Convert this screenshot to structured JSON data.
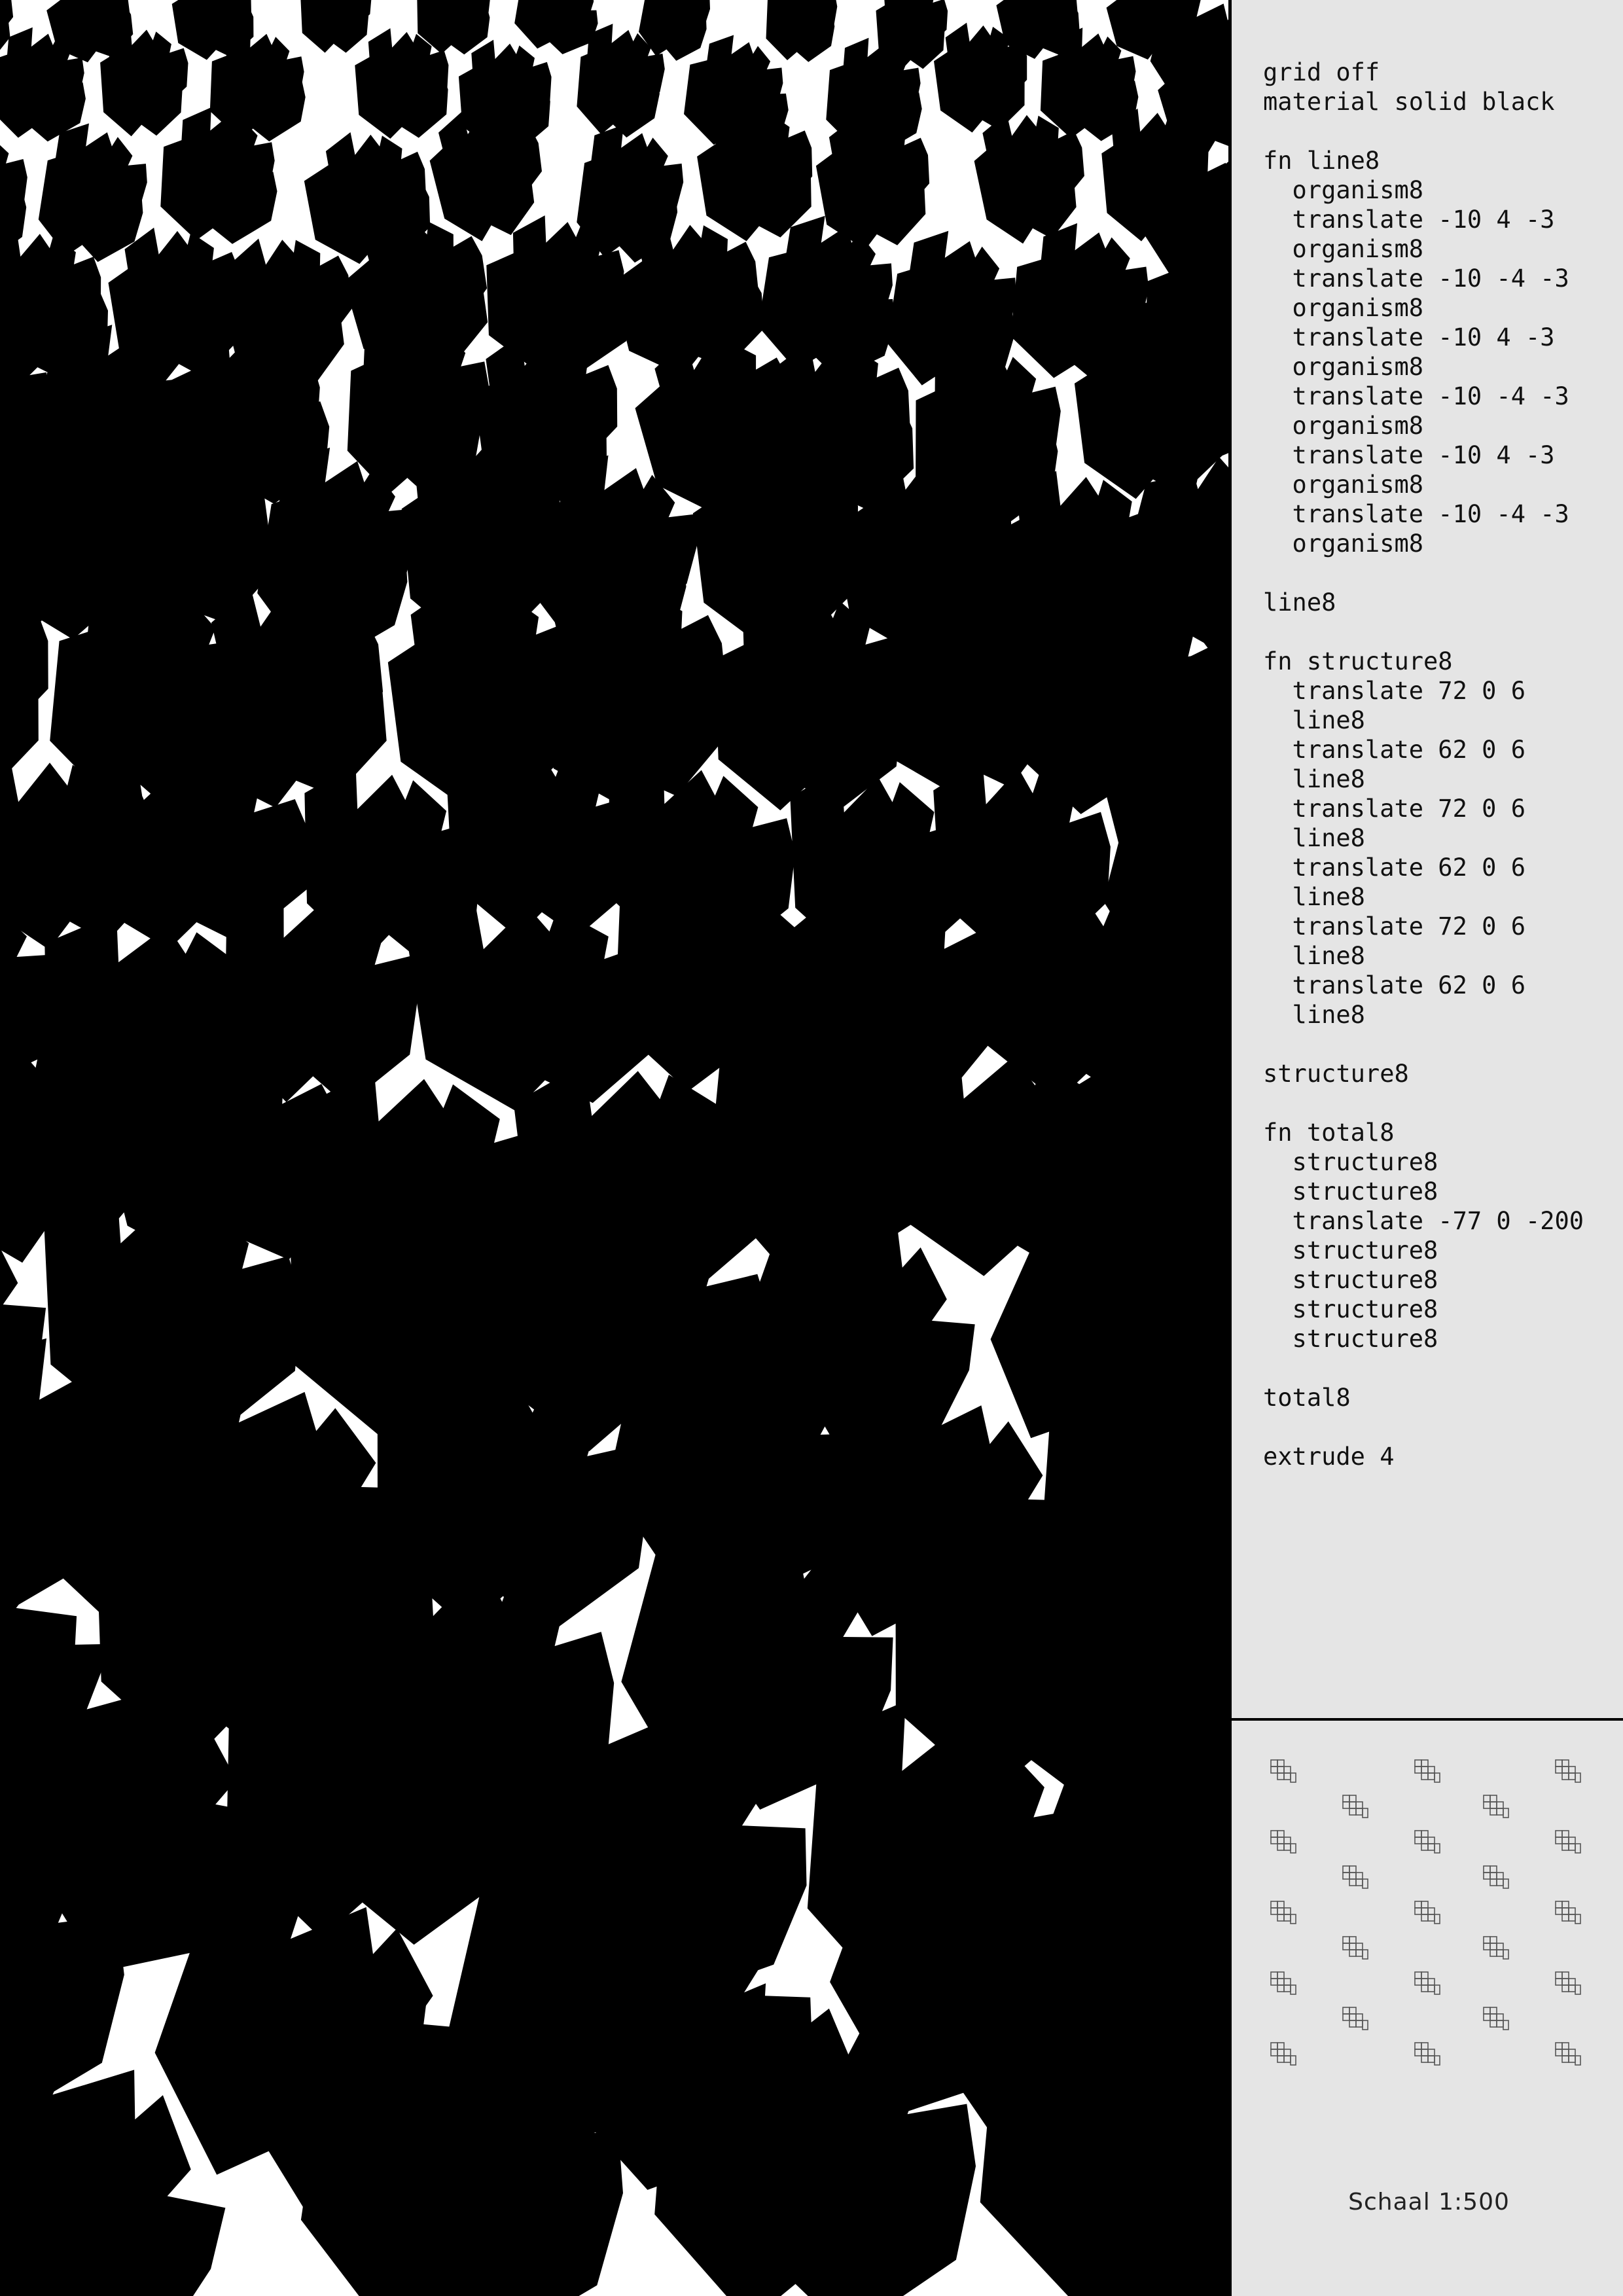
{
  "scene": {
    "background": "#ffffff",
    "material_color": "#000000"
  },
  "editor": {
    "background": "#e5e5e5",
    "lines": [
      "grid off",
      "material solid black",
      "",
      "fn line8",
      "  organism8",
      "  translate -10 4 -3",
      "  organism8",
      "  translate -10 -4 -3",
      "  organism8",
      "  translate -10 4 -3",
      "  organism8",
      "  translate -10 -4 -3",
      "  organism8",
      "  translate -10 4 -3",
      "  organism8",
      "  translate -10 -4 -3",
      "  organism8",
      "",
      "line8",
      "",
      "fn structure8",
      "  translate 72 0 6",
      "  line8",
      "  translate 62 0 6",
      "  line8",
      "  translate 72 0 6",
      "  line8",
      "  translate 62 0 6",
      "  line8",
      "  translate 72 0 6",
      "  line8",
      "  translate 62 0 6",
      "  line8",
      "",
      "structure8",
      "",
      "fn total8",
      "  structure8",
      "  structure8",
      "  translate -77 0 -200",
      "  structure8",
      "  structure8",
      "  structure8",
      "  structure8",
      "",
      "total8",
      "",
      "extrude 4"
    ]
  },
  "preview": {
    "scale_label": "Schaal 1:500",
    "icon": "plan-glyph-icon"
  }
}
